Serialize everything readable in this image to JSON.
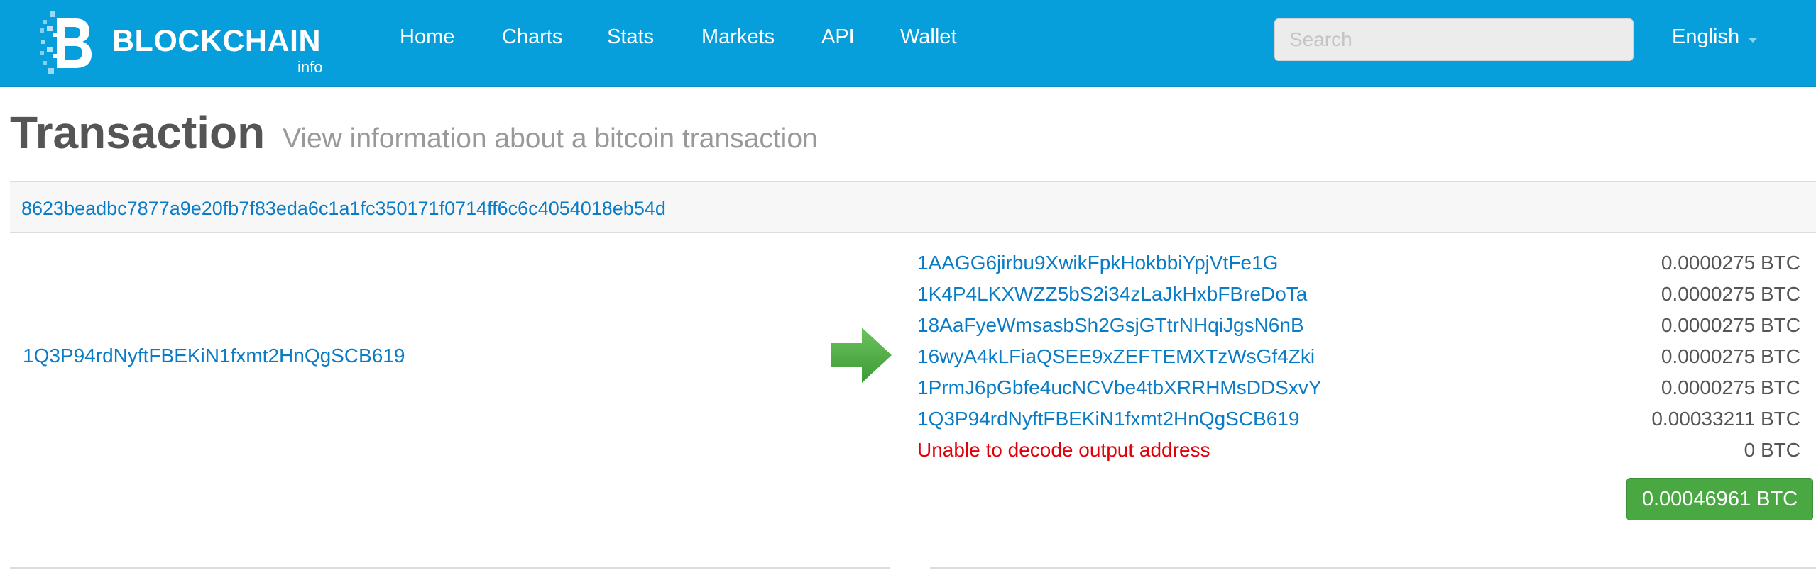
{
  "navbar": {
    "brand_title": "BLOCKCHAIN",
    "brand_sub": "info",
    "items": [
      {
        "label": "Home"
      },
      {
        "label": "Charts"
      },
      {
        "label": "Stats"
      },
      {
        "label": "Markets"
      },
      {
        "label": "API"
      },
      {
        "label": "Wallet"
      }
    ],
    "search_placeholder": "Search",
    "language": "English"
  },
  "page": {
    "title": "Transaction",
    "subtitle": "View information about a bitcoin transaction"
  },
  "transaction": {
    "hash": "8623beadbc7877a9e20fb7f83eda6c1a1fc350171f0714ff6c6c4054018eb54d",
    "input_address": "1Q3P94rdNyftFBEKiN1fxmt2HnQgSCB619",
    "outputs": [
      {
        "address": "1AAGG6jirbu9XwikFpkHokbbiYpjVtFe1G",
        "amount": "0.0000275 BTC"
      },
      {
        "address": "1K4P4LKXWZZ5bS2i34zLaJkHxbFBreDoTa",
        "amount": "0.0000275 BTC"
      },
      {
        "address": "18AaFyeWmsasbSh2GsjGTtrNHqiJgsN6nB",
        "amount": "0.0000275 BTC"
      },
      {
        "address": "16wyA4kLFiaQSEE9xZEFTEMXTzWsGf4Zki",
        "amount": "0.0000275 BTC"
      },
      {
        "address": "1PrmJ6pGbfe4ucNCVbe4tbXRRHMsDDSxvY",
        "amount": "0.0000275 BTC"
      },
      {
        "address": "1Q3P94rdNyftFBEKiN1fxmt2HnQgSCB619",
        "amount": "0.00033211 BTC"
      },
      {
        "address": "Unable to decode output address",
        "amount": "0 BTC"
      }
    ],
    "total": "0.00046961 BTC"
  },
  "colors": {
    "navbar_bg": "#069edb",
    "link": "#0a7cc6",
    "total_button": "#4aa843",
    "error_text": "#e0000a",
    "arrow": "#4aa843"
  }
}
